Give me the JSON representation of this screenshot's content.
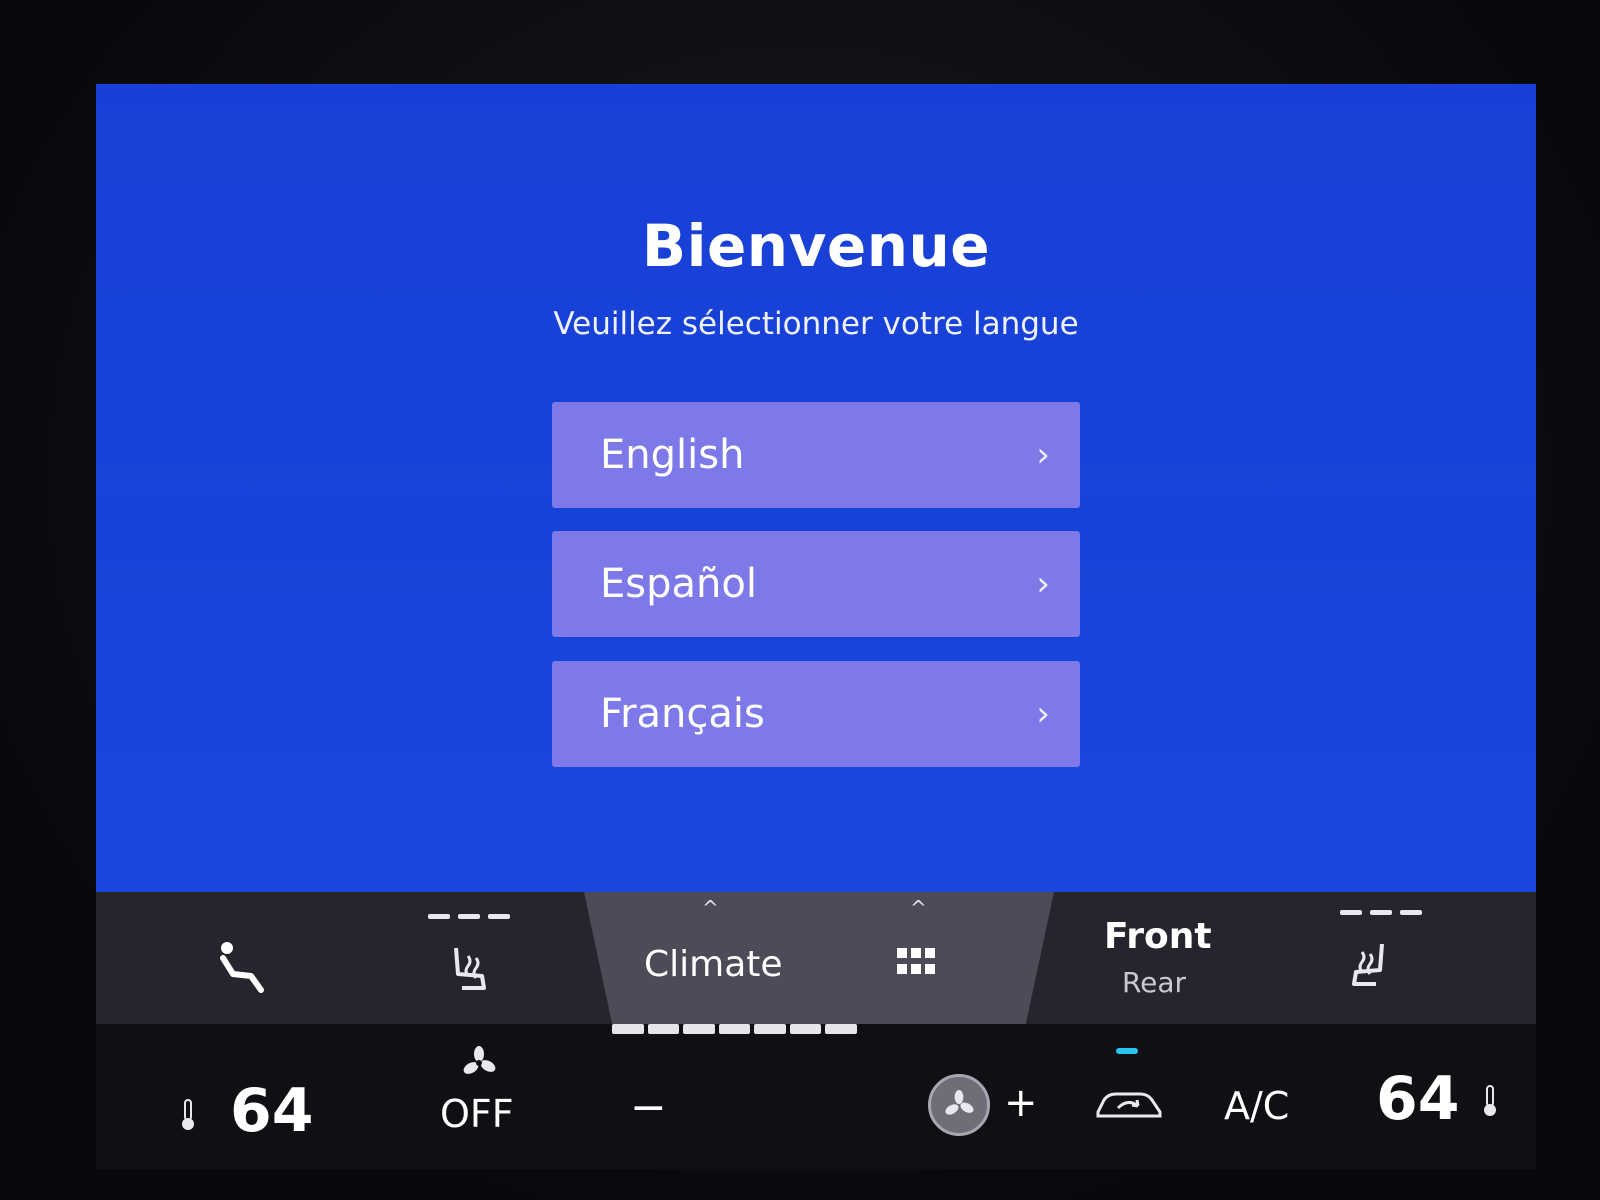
{
  "welcome": {
    "title": "Bienvenue",
    "subtitle": "Veuillez sélectionner votre langue"
  },
  "languages": [
    {
      "label": "English",
      "chevron": "›"
    },
    {
      "label": "Español",
      "chevron": "›"
    },
    {
      "label": "Français",
      "chevron": "›"
    }
  ],
  "climate_bar": {
    "center_tab_label": "Climate",
    "front_label": "Front",
    "rear_label": "Rear",
    "icons": [
      "seat-recline-icon",
      "heated-seat-icon",
      "caret-up-icon",
      "apps-grid-icon",
      "heated-seat-icon"
    ]
  },
  "controls": {
    "driver_temp": "64",
    "passenger_temp": "64",
    "fan_label": "OFF",
    "minus_label": "−",
    "plus_label": "+",
    "ac_label": "A/C",
    "fan_level_fraction": 1.0
  },
  "colors": {
    "screen_bg": "#1a3fd6",
    "button_bg": "#7d79e8",
    "bar_bg": "#25262d",
    "center_tab_bg": "#4b4c57",
    "indicator": "#27c6f0"
  }
}
